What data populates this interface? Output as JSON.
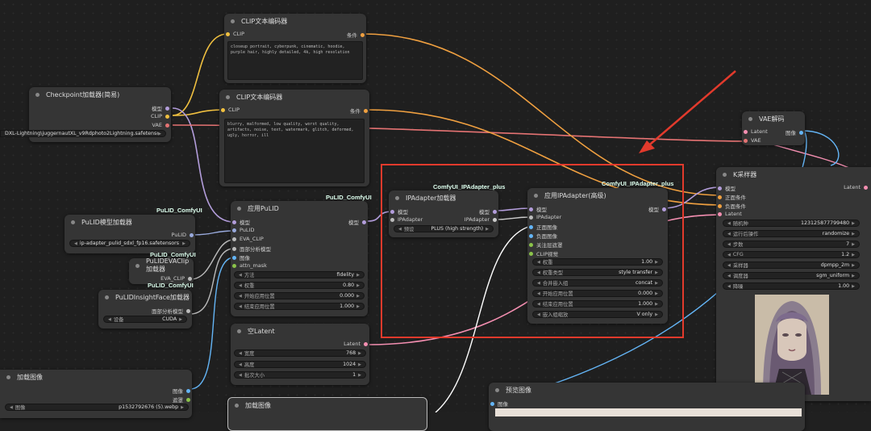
{
  "colors": {
    "clip": "#f0c040",
    "model": "#b39ddb",
    "vae": "#e57373",
    "conditioning": "#f0a040",
    "latent": "#f48fb1",
    "image": "#64b5f6",
    "accent_red": "#e23a2c",
    "tag": "#dfe"
  },
  "clip_encoder_1": {
    "title": "CLIP文本编码器",
    "in_clip": "CLIP",
    "out_cond": "条件",
    "text": "closeup portrait, cyberpunk, cinematic, hoodie, purple hair, highly detailed, 4k, high resolution"
  },
  "clip_encoder_2": {
    "title": "CLIP文本编码器",
    "in_clip": "CLIP",
    "out_cond": "条件",
    "text": "blurry, malformed, low quality, worst quality, artifacts, noise, text, watermark, glitch, deformed, ugly, horror, ill"
  },
  "checkpoint": {
    "title": "Checkpoint加载器(简易)",
    "out_model": "模型",
    "out_clip": "CLIP",
    "out_vae": "VAE",
    "ckpt_left": "DXL-Lightning\\juggernautXL_v9Rdphoto2Lightning.safetensors"
  },
  "pulid_loader": {
    "tag": "PuLID_ComfyUI",
    "title": "PuLID模型加载器",
    "out": "PuLID",
    "file": "ip-adapter_pulid_sdxl_fp16.safetensors"
  },
  "eva_loader": {
    "tag": "PuLID_ComfyUI",
    "title": "PuLIDEVAClip加载器",
    "out": "EVA_CLIP"
  },
  "insightface_loader": {
    "tag": "PuLID_ComfyUI",
    "title": "PuLIDInsightFace加载器",
    "out": "面部分析模型",
    "prov_label": "设备",
    "prov_value": "CUDA"
  },
  "apply_pulid": {
    "tag": "PuLID_ComfyUI",
    "title": "应用PuLID",
    "in_model": "模型",
    "in_pulid": "PuLID",
    "in_eva": "EVA_CLIP",
    "in_face": "面部分析模型",
    "in_image": "图像",
    "in_mask": "attn_mask",
    "out_model": "模型",
    "widgets": [
      {
        "label": "方法",
        "value": "fidelity"
      },
      {
        "label": "权重",
        "value": "0.80"
      },
      {
        "label": "开始应用位置",
        "value": "0.000"
      },
      {
        "label": "结束应用位置",
        "value": "1.000"
      }
    ]
  },
  "empty_latent": {
    "title": "空Latent",
    "out": "Latent",
    "widgets": [
      {
        "label": "宽度",
        "value": "768"
      },
      {
        "label": "高度",
        "value": "1024"
      },
      {
        "label": "批次大小",
        "value": "1"
      }
    ]
  },
  "load_image": {
    "title": "加载图像",
    "out_image": "图像",
    "out_mask": "遮罩",
    "img_label": "图像",
    "img_value": "p1532792676 (5).webp"
  },
  "load_image_2": {
    "title": "加载图像"
  },
  "ipa_loader": {
    "tag": "ComfyUI_IPAdapter_plus",
    "title": "IPAdapter加载器",
    "in_model": "模型",
    "in_ipa": "IPAdapter",
    "out_model": "模型",
    "out_ipa": "IPAdapter",
    "preset_label": "预设",
    "preset_value": "PLUS (high strength)"
  },
  "ipa_advanced": {
    "tag": "ComfyUI_IPAdapter_plus",
    "title": "应用IPAdapter(高级)",
    "in_model": "模型",
    "in_ipa": "IPAdapter",
    "in_pos": "正面图像",
    "in_neg": "负面图像",
    "in_mask": "关注层遮罩",
    "in_clipv": "CLIP视觉",
    "out_model": "模型",
    "widgets": [
      {
        "label": "权重",
        "value": "1.00"
      },
      {
        "label": "权重类型",
        "value": "style transfer"
      },
      {
        "label": "合并嵌入组",
        "value": "concat"
      },
      {
        "label": "开始应用位置",
        "value": "0.000"
      },
      {
        "label": "结束应用位置",
        "value": "1.000"
      },
      {
        "label": "嵌入组缩放",
        "value": "V only"
      }
    ]
  },
  "vae_decode": {
    "title": "VAE解码",
    "in_latent": "Latent",
    "in_vae": "VAE",
    "out": "图像"
  },
  "ksampler": {
    "title": "K采样器",
    "in_model": "模型",
    "in_pos": "正面条件",
    "in_neg": "负面条件",
    "in_latent": "Latent",
    "out": "Latent",
    "widgets": [
      {
        "label": "随机种",
        "value": "123125877799480"
      },
      {
        "label": "运行后操作",
        "value": "randomize"
      },
      {
        "label": "步数",
        "value": "7"
      },
      {
        "label": "CFG",
        "value": "1.2"
      },
      {
        "label": "采样器",
        "value": "dpmpp_2m"
      },
      {
        "label": "调度器",
        "value": "sgm_uniform"
      },
      {
        "label": "降噪",
        "value": "1.00"
      }
    ]
  },
  "preview": {
    "title": "预览图像",
    "in": "图像"
  }
}
